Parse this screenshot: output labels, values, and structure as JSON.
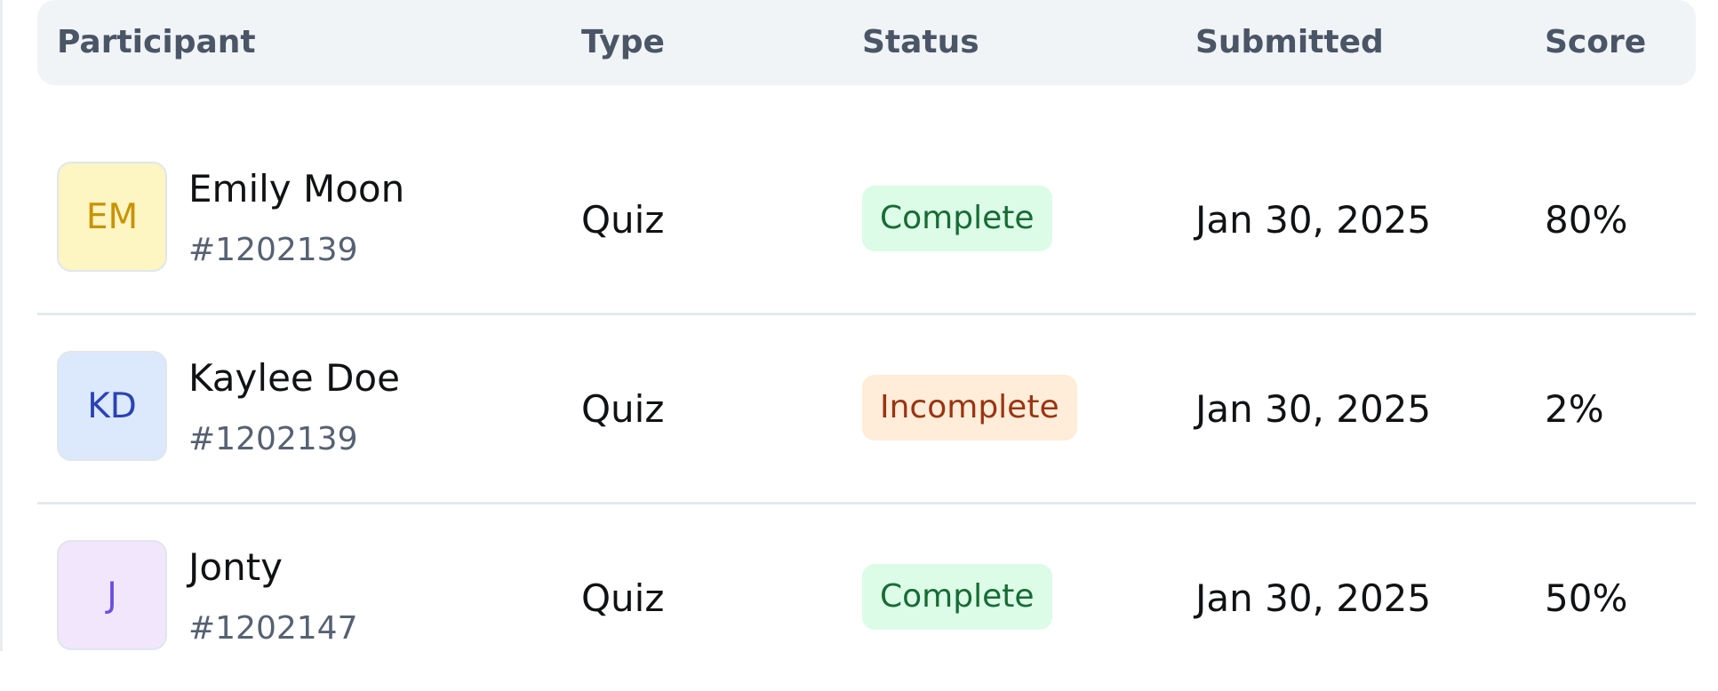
{
  "table": {
    "columns": {
      "participant": "Participant",
      "type": "Type",
      "status": "Status",
      "submitted": "Submitted",
      "score": "Score"
    },
    "rows": [
      {
        "initials": "EM",
        "name": "Emily Moon",
        "id": "#1202139",
        "type": "Quiz",
        "status": "Complete",
        "submitted": "Jan 30, 2025",
        "score": "80%",
        "avatar_bg": "#fdf5c2",
        "avatar_fg": "#c99300",
        "badge_bg": "#dcfce7",
        "badge_fg": "#176b35"
      },
      {
        "initials": "KD",
        "name": "Kaylee Doe",
        "id": "#1202139",
        "type": "Quiz",
        "status": "Incomplete",
        "submitted": "Jan 30, 2025",
        "score": "2%",
        "avatar_bg": "#dce9fd",
        "avatar_fg": "#2b43b4",
        "badge_bg": "#ffedd9",
        "badge_fg": "#9a3412"
      },
      {
        "initials": "J",
        "name": "Jonty",
        "id": "#1202147",
        "type": "Quiz",
        "status": "Complete",
        "submitted": "Jan 30, 2025",
        "score": "50%",
        "avatar_bg": "#f2e6fd",
        "avatar_fg": "#6b4fe0",
        "badge_bg": "#dcfce7",
        "badge_fg": "#176b35"
      }
    ]
  }
}
